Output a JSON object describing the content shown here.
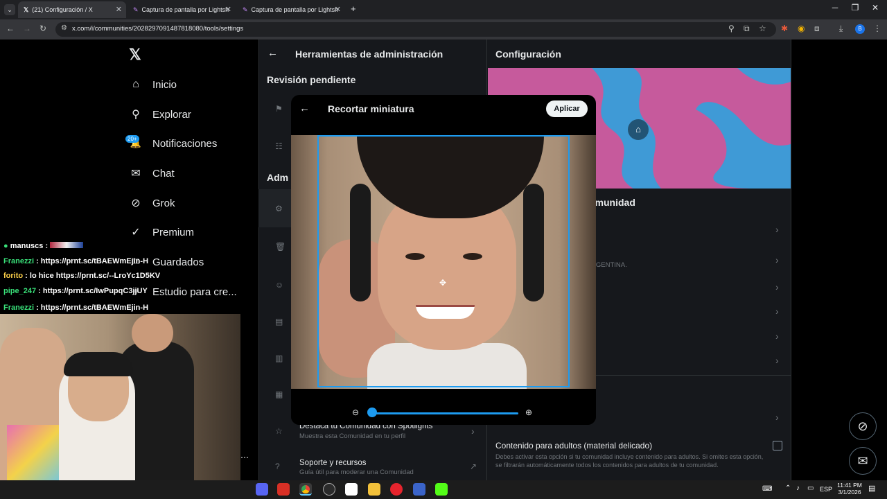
{
  "browser": {
    "tabs": [
      {
        "label": "(21) Configuración / X"
      },
      {
        "label": "Captura de pantalla por Lightsh"
      },
      {
        "label": "Captura de pantalla por Lightsh"
      }
    ],
    "new_tab": "+",
    "url": "x.com/i/communities/2028297091487818080/tools/settings",
    "profile_initial": "B",
    "window_controls": [
      "─",
      "❐",
      "✕"
    ]
  },
  "x_sidebar": {
    "logo": "𝕏",
    "items": [
      {
        "label": "Inicio",
        "icon": "home-icon",
        "glyph": "⌂"
      },
      {
        "label": "Explorar",
        "icon": "search-icon",
        "glyph": "⚲"
      },
      {
        "label": "Notificaciones",
        "icon": "bell-icon",
        "glyph": "🔔",
        "badge": "20+"
      },
      {
        "label": "Chat",
        "icon": "mail-icon",
        "glyph": "✉"
      },
      {
        "label": "Grok",
        "icon": "grok-icon",
        "glyph": "⊘"
      },
      {
        "label": "Premium",
        "icon": "premium-icon",
        "glyph": "✓"
      },
      {
        "label": "Guardados",
        "icon": "bookmark-icon",
        "glyph": "⌑"
      },
      {
        "label": "Estudio para cre...",
        "icon": "studio-icon",
        "glyph": "✦"
      }
    ]
  },
  "chat_messages": [
    {
      "user": "manuscs",
      "text": ":",
      "user_color": "#e7e9ea"
    },
    {
      "user": "Franezzi",
      "text": ": https://prnt.sc/tBAEWmEjin-H",
      "user_color": "#39e079"
    },
    {
      "user": "forito",
      "text": ": lo hice https://prnt.sc/--LroYc1D5KV",
      "user_color": "#ffd24a"
    },
    {
      "user": "pipe_247",
      "text": ": https://prnt.sc/IwPupqC3jjUY",
      "user_color": "#39e079"
    },
    {
      "user": "Franezzi",
      "text": ": https://prnt.sc/tBAEWmEjin-H",
      "user_color": "#39e079"
    }
  ],
  "admin_tools": {
    "title": "Herramientas de administración",
    "pending_section": "Revisión pendiente",
    "admin_section": "Adm",
    "spotlight": {
      "title": "Destaca tu Comunidad con Spotlights",
      "subtitle": "Muestra esta Comunidad en tu perfil"
    },
    "support": {
      "title": "Soporte y recursos",
      "subtitle": "Guía útil para moderar una Comunidad"
    }
  },
  "settings": {
    "title": "Configuración",
    "community_heading": "omunidad",
    "location_snippet": "RGENTINA.",
    "adult_content": {
      "title": "Contenido para adultos (material delicado)",
      "description": "Debes activar esta opción si tu comunidad incluye contenido para adultos. Si omites esta opción, se filtrarán automáticamente todos los contenidos para adultos de tu comunidad."
    }
  },
  "crop_modal": {
    "title": "Recortar miniatura",
    "apply_label": "Aplicar",
    "zoom_level": 0.0
  },
  "taskbar": {
    "lang": "ESP",
    "time": "11:41 PM",
    "date": "3/1/2026"
  },
  "colors": {
    "accent": "#1d9bf0",
    "banner_pink": "#c65a9c",
    "banner_blue": "#3f9ad6"
  }
}
